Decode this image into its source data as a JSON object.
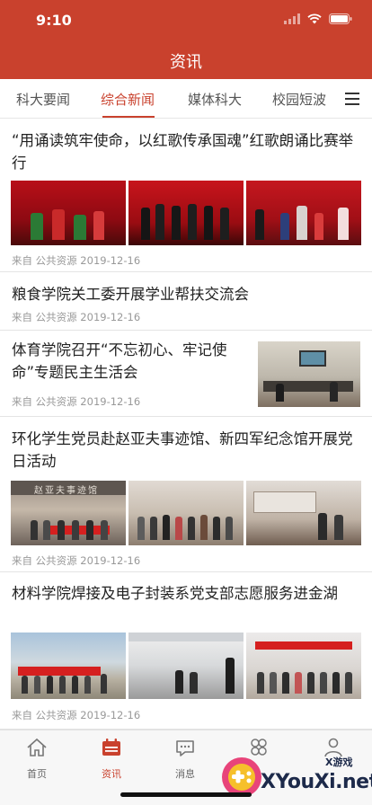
{
  "status": {
    "time": "9:10"
  },
  "header": {
    "title": "资讯"
  },
  "tabs": [
    {
      "label": "科大要闻"
    },
    {
      "label": "综合新闻",
      "active": true
    },
    {
      "label": "媒体科大"
    },
    {
      "label": "校园短波"
    }
  ],
  "articles": [
    {
      "title": "“用诵读筑牢使命，以红歌传承国魂”红歌朗诵比赛举行",
      "meta": "来自 公共资源 2019-12-16"
    },
    {
      "title": "粮食学院关工委开展学业帮扶交流会",
      "meta": "来自 公共资源 2019-12-16"
    },
    {
      "title": "体育学院召开“不忘初心、牢记使命”专题民主生活会",
      "meta": "来自 公共资源 2019-12-16"
    },
    {
      "title": "环化学生党员赴赵亚夫事迹馆、新四军纪念馆开展党日活动",
      "meta": "来自 公共资源 2019-12-16",
      "photo_sign": "赵亚夫事迹馆"
    },
    {
      "title": "材料学院焊接及电子封装系党支部志愿服务进金湖",
      "meta": "来自 公共资源 2019-12-16"
    }
  ],
  "tabbar": [
    {
      "label": "首页",
      "icon": "home-icon"
    },
    {
      "label": "资讯",
      "icon": "news-icon",
      "active": true
    },
    {
      "label": "消息",
      "icon": "message-icon"
    },
    {
      "label": "",
      "icon": "apps-icon"
    },
    {
      "label": "",
      "icon": "profile-icon"
    }
  ],
  "watermark": {
    "brand": "XYouXi.net",
    "small": "X游戏"
  },
  "colors": {
    "primary": "#c9412d",
    "meta": "#999999",
    "divider": "#e4e4e4"
  }
}
